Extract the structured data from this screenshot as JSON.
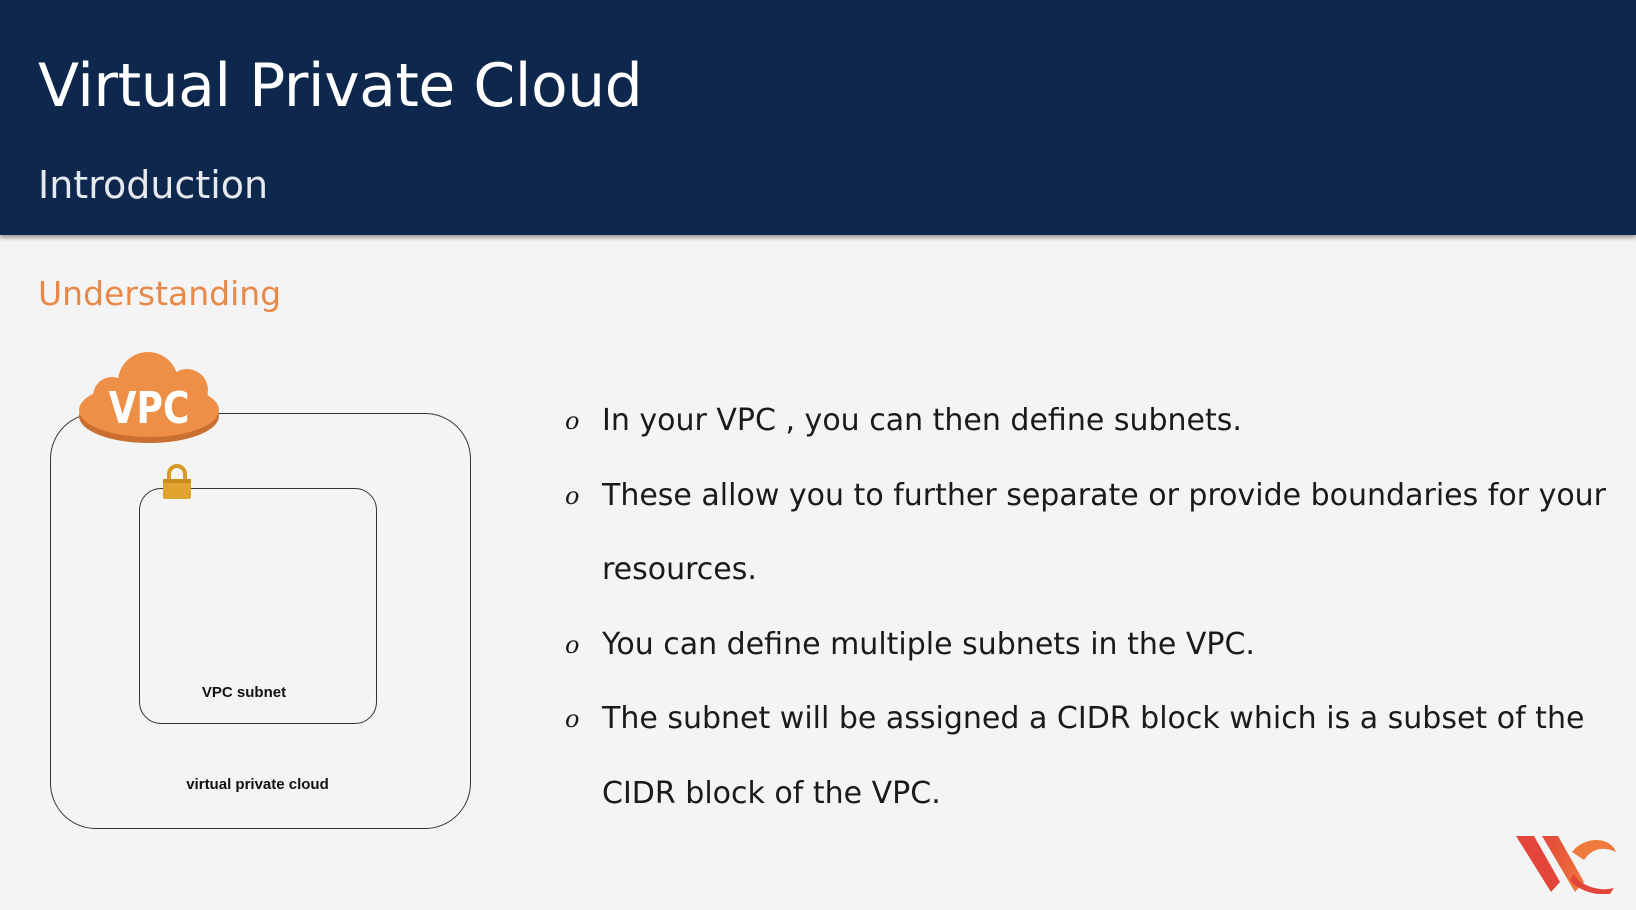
{
  "header": {
    "title": "Virtual Private Cloud",
    "subtitle": "Introduction"
  },
  "section": {
    "heading": "Understanding"
  },
  "diagram": {
    "cloud_label": "VPC",
    "subnet_label": "VPC subnet",
    "vpc_label": "virtual private cloud",
    "cloud_color": "#ee8f47",
    "lock_color": "#e0a52e"
  },
  "bullets": [
    {
      "marker": "o",
      "text": "In your VPC , you can then define subnets."
    },
    {
      "marker": "o",
      "text": "These allow you to further separate or provide boundaries for your resources."
    },
    {
      "marker": "o",
      "text": "You can define multiple subnets in the VPC."
    },
    {
      "marker": "o",
      "text": "The subnet will be assigned a CIDR block which is a subset of the CIDR block of the VPC."
    }
  ],
  "colors": {
    "header_bg": "#0e284d",
    "accent": "#e8894a",
    "logo_red": "#e2463a",
    "logo_orange": "#f07a3c"
  }
}
